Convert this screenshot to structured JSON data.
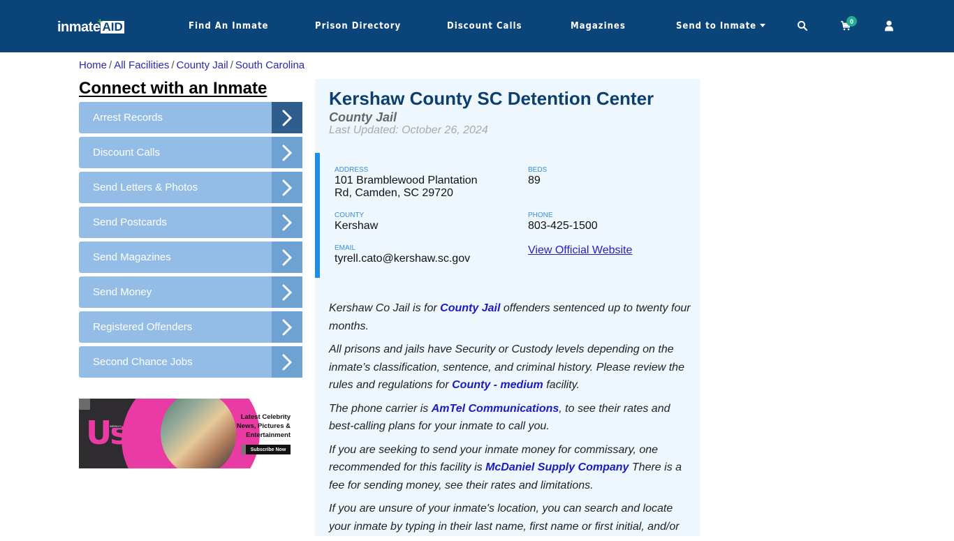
{
  "header": {
    "logo": {
      "text_main": "inmate",
      "text_box": "AID",
      "plus": "+"
    },
    "nav": [
      {
        "label": "Find An Inmate"
      },
      {
        "label": "Prison Directory"
      },
      {
        "label": "Discount Calls"
      },
      {
        "label": "Magazines"
      },
      {
        "label": "Send to Inmate",
        "has_dropdown": true
      }
    ],
    "icons": [
      "search-icon",
      "cart-icon",
      "user-icon"
    ],
    "cart_count": "0"
  },
  "breadcrumb": [
    {
      "label": "Home"
    },
    {
      "label": "All Facilities"
    },
    {
      "label": "County Jail"
    },
    {
      "label": "South Carolina"
    }
  ],
  "breadcrumb_separator": "/",
  "sidebar": {
    "title": "Connect with an Inmate",
    "items": [
      {
        "label": "Arrest Records"
      },
      {
        "label": "Discount Calls"
      },
      {
        "label": "Send Letters & Photos"
      },
      {
        "label": "Send Postcards"
      },
      {
        "label": "Send Magazines"
      },
      {
        "label": "Send Money"
      },
      {
        "label": "Registered Offenders"
      },
      {
        "label": "Second Chance Jobs"
      }
    ]
  },
  "ad": {
    "brand": "Us",
    "brand_tag": "WEEKLY",
    "tagline_1": "Latest Celebrity",
    "tagline_2": "News, Pictures &",
    "tagline_3": "Entertainment",
    "cta": "Subscribe Now"
  },
  "facility": {
    "name": "Kershaw County SC Detention Center",
    "type": "County Jail",
    "last_updated": "Last Updated: October 26, 2024",
    "address_label": "ADDRESS",
    "address_line1": "101 Bramblewood Plantation",
    "address_line2": "Rd, Camden, SC 29720",
    "beds_label": "BEDS",
    "beds": "89",
    "county_label": "COUNTY",
    "county": "Kershaw",
    "phone_label": "PHONE",
    "phone": "803-425-1500",
    "email_label": "EMAIL",
    "email": "tyrell.cato@kershaw.sc.gov",
    "website_link": "View Official Website"
  },
  "description": {
    "p1_a": "Kershaw Co Jail is for ",
    "p1_link": "County Jail",
    "p1_b": " offenders sentenced up to twenty four months.",
    "p2_a": "All prisons and jails have Security or Custody levels depending on the inmate’s classification, sentence, and criminal history. Please review the rules and regulations for ",
    "p2_link": "County - medium",
    "p2_b": " facility.",
    "p3_a": "The phone carrier is ",
    "p3_link": "AmTel Communications",
    "p3_b": ", to see their rates and best-calling plans for your inmate to call you.",
    "p4_a": "If you are seeking to send your inmate money for commissary, one recommended for this facility is ",
    "p4_link": "McDaniel Supply Company",
    "p4_b": " There is a fee for sending money, see their rates and limitations.",
    "p5": "If you are unsure of your inmate's location, you can search and locate your inmate by typing in their last name, first name or first initial, and/or"
  }
}
